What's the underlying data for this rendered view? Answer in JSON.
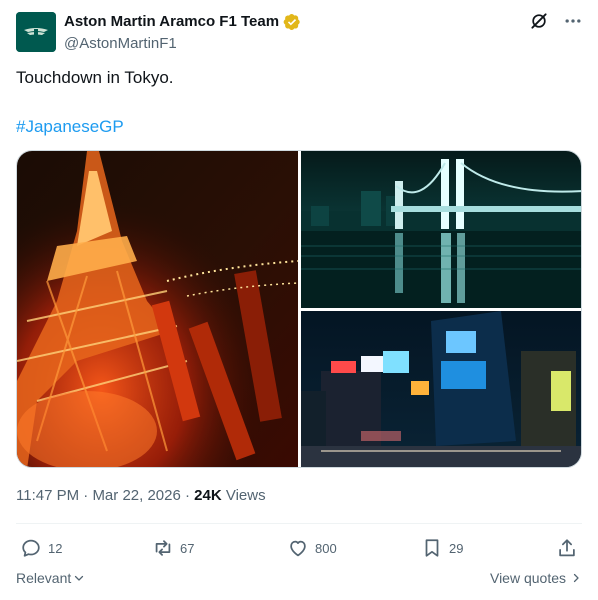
{
  "author": {
    "display_name": "Aston Martin Aramco F1 Team",
    "handle": "@AstonMartinF1",
    "verified_badge_color": "#e2b719",
    "avatar_color": "#00594f"
  },
  "tweet": {
    "text": "Touchdown in Tokyo.",
    "hashtag": "#JapaneseGP",
    "hashtag_color": "#1d9bf0"
  },
  "meta": {
    "time": "11:47 PM",
    "separator": " · ",
    "date": "Mar 22, 2026",
    "views_count": "24K",
    "views_label": " Views"
  },
  "actions": {
    "replies": "12",
    "reposts": "67",
    "likes": "800",
    "bookmarks": "29"
  },
  "footer": {
    "sort_label": "Relevant",
    "view_quotes_label": "View quotes"
  },
  "icons": {
    "top_right": [
      "grok-icon",
      "more-icon"
    ],
    "actions": [
      "reply-icon",
      "repost-icon",
      "like-icon",
      "bookmark-icon",
      "share-icon"
    ]
  }
}
